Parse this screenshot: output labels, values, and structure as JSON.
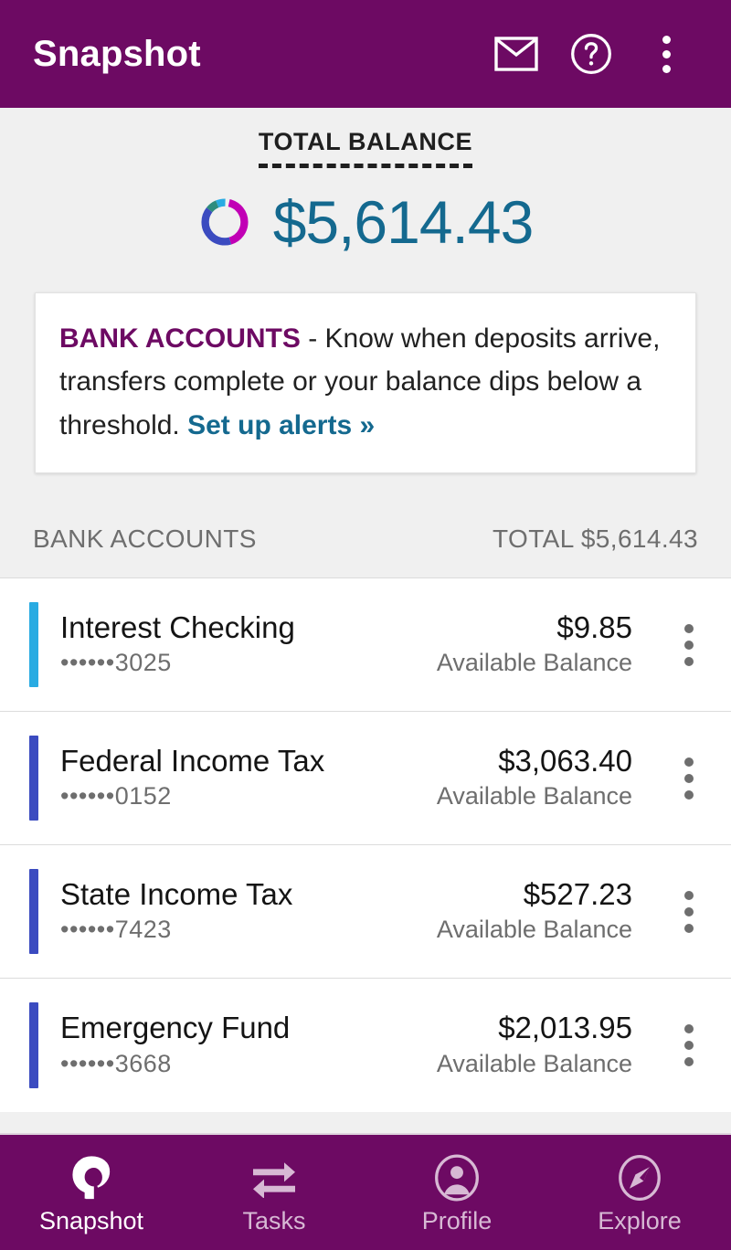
{
  "theme": {
    "brand_purple": "#6D0A63",
    "accent_blue": "#14698F",
    "page_background": "#F0F0F0",
    "row_background": "#FFFFFF",
    "muted_text": "#6E6E6E"
  },
  "appbar": {
    "title": "Snapshot",
    "actions": [
      {
        "name": "mail-icon",
        "label": "Messages"
      },
      {
        "name": "help-icon",
        "label": "Help"
      },
      {
        "name": "overflow-menu-icon",
        "label": "More options"
      }
    ]
  },
  "balance": {
    "label": "TOTAL BALANCE",
    "amount": "$5,614.43",
    "donut_segments": [
      {
        "color": "#C100B5",
        "portion": 0.42
      },
      {
        "color": "#3B4BC0",
        "portion": 0.4
      },
      {
        "color": "#2E8C7E",
        "portion": 0.08
      },
      {
        "color": "#29ABE2",
        "portion": 0.1
      }
    ]
  },
  "promo": {
    "strong": "BANK ACCOUNTS",
    "body": " - Know when deposits arrive, transfers complete or your balance dips below a threshold. ",
    "link": "Set up alerts »"
  },
  "section": {
    "title": "BANK ACCOUNTS",
    "total": "TOTAL $5,614.43"
  },
  "accounts": [
    {
      "name": "Interest Checking",
      "mask": "••••••3025",
      "amount": "$9.85",
      "sub": "Available Balance",
      "bar_color": "#29ABE2"
    },
    {
      "name": "Federal Income Tax",
      "mask": "••••••0152",
      "amount": "$3,063.40",
      "sub": "Available Balance",
      "bar_color": "#3B4BC0"
    },
    {
      "name": "State Income Tax",
      "mask": "••••••7423",
      "amount": "$527.23",
      "sub": "Available Balance",
      "bar_color": "#3B4BC0"
    },
    {
      "name": "Emergency Fund",
      "mask": "••••••3668",
      "amount": "$2,013.95",
      "sub": "Available Balance",
      "bar_color": "#3B4BC0"
    }
  ],
  "bottom_nav": {
    "items": [
      {
        "label": "Snapshot",
        "icon": "snapshot-logo-icon",
        "active": true
      },
      {
        "label": "Tasks",
        "icon": "transfer-arrows-icon",
        "active": false
      },
      {
        "label": "Profile",
        "icon": "person-circle-icon",
        "active": false
      },
      {
        "label": "Explore",
        "icon": "compass-icon",
        "active": false
      }
    ]
  }
}
